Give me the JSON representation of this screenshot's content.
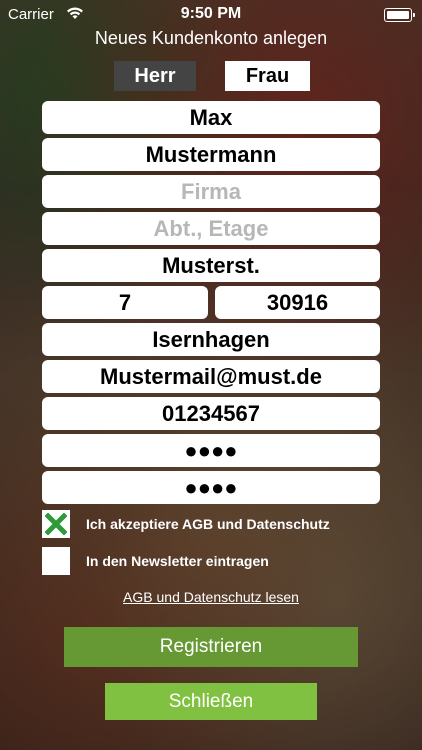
{
  "status": {
    "carrier": "Carrier",
    "time": "9:50 PM"
  },
  "title": "Neues Kundenkonto anlegen",
  "gender": {
    "herr": "Herr",
    "frau": "Frau"
  },
  "fields": {
    "first_name": "Max",
    "last_name": "Mustermann",
    "company_placeholder": "Firma",
    "department_placeholder": "Abt., Etage",
    "street": "Musterst.",
    "house_number": "7",
    "zip": "30916",
    "city": "Isernhagen",
    "email": "Mustermail@must.de",
    "phone": "01234567",
    "password": "●●●●",
    "password_confirm": "●●●●"
  },
  "checks": {
    "agb_label": "Ich akzeptiere AGB und Datenschutz",
    "agb_checked": true,
    "newsletter_label": "In den Newsletter eintragen",
    "newsletter_checked": false
  },
  "links": {
    "agb": "AGB und Datenschutz lesen"
  },
  "buttons": {
    "register": "Registrieren",
    "close": "Schließen"
  },
  "colors": {
    "register_bg": "#669933",
    "close_bg": "#80c141",
    "check_green": "#2e9a3a"
  }
}
